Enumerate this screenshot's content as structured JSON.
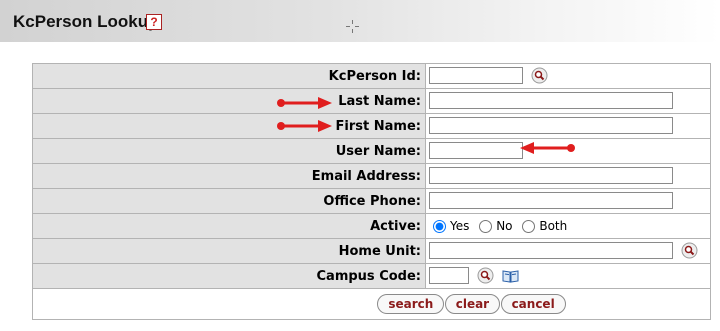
{
  "header": {
    "title": "KcPerson Lookup",
    "help_icon_text": "?"
  },
  "form": {
    "fields": [
      {
        "label": "KcPerson Id:",
        "type": "text",
        "value": "",
        "lookup": true
      },
      {
        "label": "Last Name:",
        "type": "text",
        "value": "",
        "highlighted": true
      },
      {
        "label": "First Name:",
        "type": "text",
        "value": "",
        "highlighted": true
      },
      {
        "label": "User Name:",
        "type": "text",
        "value": "",
        "highlighted": true
      },
      {
        "label": "Email Address:",
        "type": "text",
        "value": ""
      },
      {
        "label": "Office Phone:",
        "type": "text",
        "value": ""
      },
      {
        "label": "Active:",
        "type": "radio",
        "options": [
          "Yes",
          "No",
          "Both"
        ],
        "selected": "Yes"
      },
      {
        "label": "Home Unit:",
        "type": "text",
        "value": "",
        "lookup": true
      },
      {
        "label": "Campus Code:",
        "type": "text",
        "value": "",
        "lookup": true,
        "direct_inquiry": true
      }
    ],
    "buttons": {
      "search": "search",
      "clear": "clear",
      "cancel": "cancel"
    }
  },
  "annotations": {
    "arrow_color": "#e01e1e"
  },
  "icons": [
    "help-icon",
    "search-lookup-icon",
    "direct-inquiry-book-icon",
    "move-cursor-icon",
    "arrow-annotation"
  ]
}
